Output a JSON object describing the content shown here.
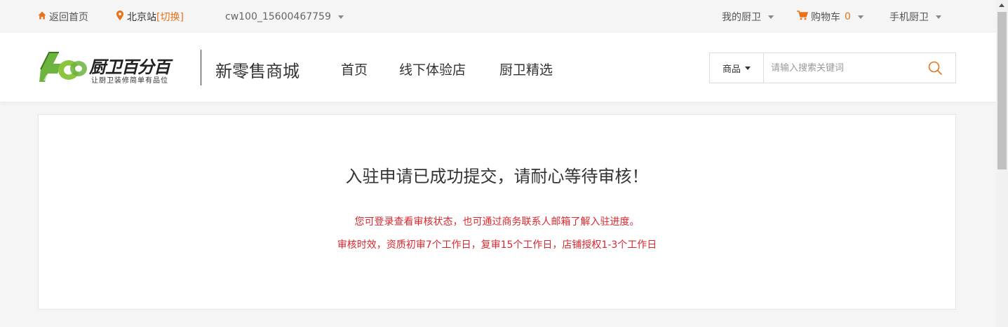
{
  "topbar": {
    "home_label": "返回首页",
    "city_name": "北京站",
    "city_switch": "[切换]",
    "account": "cw100_15600467759",
    "my_kitchen": "我的厨卫",
    "cart_label": "购物车",
    "cart_count": "0",
    "mobile": "手机厨卫"
  },
  "header": {
    "logo_text": "厨卫百分百",
    "logo_slogan": "让厨卫装修简单有品位",
    "mall_title": "新零售商城",
    "nav": [
      "首页",
      "线下体验店",
      "厨卫精选"
    ],
    "search_category": "商品",
    "search_placeholder": "请输入搜索关键词"
  },
  "main": {
    "title": "入驻申请已成功提交，请耐心等待审核！",
    "line1": "您可登录查看审核状态，也可通过商务联系人邮箱了解入驻进度。",
    "line2": "审核时效，资质初审7个工作日，复审15个工作日，店铺授权1-3个工作日"
  },
  "colors": {
    "accent": "#e8731a",
    "notice": "#d9272e",
    "logo_green": "#6db33f"
  },
  "icons": {
    "home": "home-icon",
    "location": "location-pin-icon",
    "cart": "cart-icon",
    "search": "search-icon"
  }
}
